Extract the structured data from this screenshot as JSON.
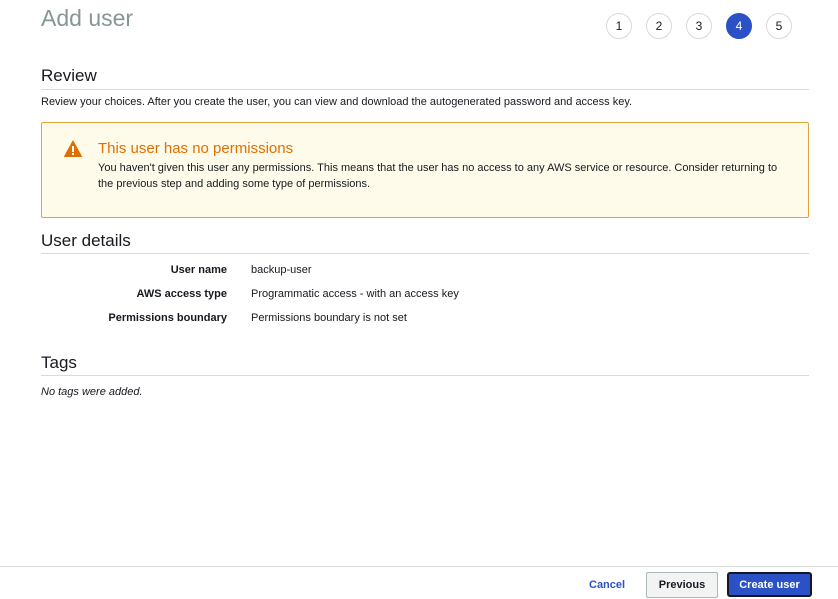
{
  "header": {
    "title": "Add user",
    "steps": [
      {
        "label": "1",
        "active": false
      },
      {
        "label": "2",
        "active": false
      },
      {
        "label": "3",
        "active": false
      },
      {
        "label": "4",
        "active": true
      },
      {
        "label": "5",
        "active": false
      }
    ]
  },
  "review": {
    "heading": "Review",
    "description": "Review your choices. After you create the user, you can view and download the autogenerated password and access key."
  },
  "alert": {
    "icon": "warning-icon",
    "title": "This user has no permissions",
    "body": "You haven't given this user any permissions. This means that the user has no access to any AWS service or resource. Consider returning to the previous step and adding some type of permissions."
  },
  "user_details": {
    "heading": "User details",
    "rows": [
      {
        "label": "User name",
        "value": "backup-user"
      },
      {
        "label": "AWS access type",
        "value": "Programmatic access - with an access key"
      },
      {
        "label": "Permissions boundary",
        "value": "Permissions boundary is not set"
      }
    ]
  },
  "tags": {
    "heading": "Tags",
    "empty_text": "No tags were added."
  },
  "footer": {
    "cancel_label": "Cancel",
    "previous_label": "Previous",
    "create_label": "Create user"
  },
  "colors": {
    "accent": "#2a51c6",
    "warning": "#df6f00",
    "warning_bg": "#fffbea",
    "warning_border": "#e0a53a"
  }
}
